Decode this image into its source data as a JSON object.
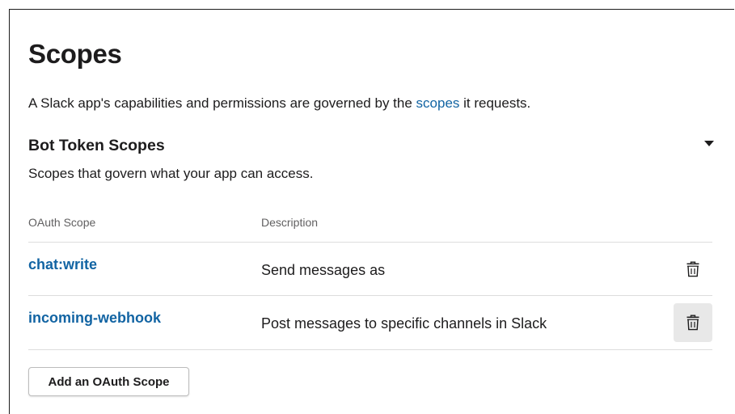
{
  "header": {
    "title": "Scopes",
    "intro_before": "A Slack app's capabilities and permissions are governed by the ",
    "intro_link": "scopes",
    "intro_after": " it requests."
  },
  "bot_token_section": {
    "title": "Bot Token Scopes",
    "description": "Scopes that govern what your app can access.",
    "toggle_icon": "caret-down-icon",
    "columns": {
      "scope": "OAuth Scope",
      "description": "Description"
    },
    "rows": [
      {
        "scope": "chat:write",
        "description": "Send messages as",
        "action_icon": "trash-icon",
        "hovered": false
      },
      {
        "scope": "incoming-webhook",
        "description": "Post messages to specific channels in Slack",
        "action_icon": "trash-icon",
        "hovered": true
      }
    ],
    "add_button_label": "Add an OAuth Scope"
  },
  "colors": {
    "link": "#1264a3",
    "text": "#1d1c1d",
    "muted": "#616061",
    "hover_bg": "#e8e8e8",
    "divider": "#dddddd"
  }
}
